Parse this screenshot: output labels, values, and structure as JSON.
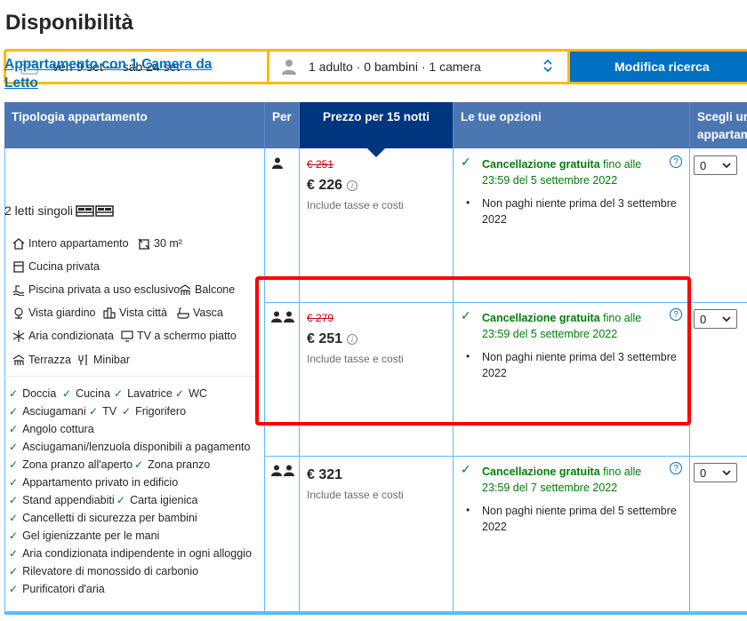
{
  "page": {
    "title": "Disponibilità"
  },
  "search": {
    "dates": "ven 9 set — sab 24 set",
    "guests": "1 adulto · 0 bambini · 1 camera",
    "button": "Modifica ricerca"
  },
  "table": {
    "headers": {
      "type": "Tipologia appartamento",
      "per": "Per",
      "price": "Prezzo per 15 notti",
      "options": "Le tue opzioni",
      "choose": "Scegli un appartam"
    },
    "room": {
      "name": "Appartamento con 1 Camera da Letto",
      "beds": "2 letti singoli",
      "facilities": [
        {
          "label": "Intero appartamento",
          "icon": "house-icon"
        },
        {
          "label": "30 m²",
          "icon": "area-icon"
        },
        {
          "label": "Cucina privata",
          "icon": "kitchen-icon"
        },
        {
          "label": "Piscina privata a uso esclusivo",
          "icon": "pool-icon"
        },
        {
          "label": "Balcone",
          "icon": "balcony-icon"
        },
        {
          "label": "Vista giardino",
          "icon": "garden-icon"
        },
        {
          "label": "Vista città",
          "icon": "city-icon"
        },
        {
          "label": "Vasca",
          "icon": "bathtub-icon"
        },
        {
          "label": "Aria condizionata",
          "icon": "snowflake-icon"
        },
        {
          "label": "TV a schermo piatto",
          "icon": "tv-icon"
        },
        {
          "label": "Terrazza",
          "icon": "terrace-icon"
        },
        {
          "label": "Minibar",
          "icon": "minibar-icon"
        }
      ],
      "amenities": [
        "Doccia",
        "Cucina",
        "Lavatrice",
        "WC",
        "Asciugamani",
        "TV",
        "Frigorifero",
        "Angolo cottura",
        "Asciugamani/lenzuola disponibili a pagamento",
        "Zona pranzo all'aperto",
        "Zona pranzo",
        "Appartamento privato in edificio",
        "Stand appendiabiti",
        "Carta igienica",
        "Cancelletti di sicurezza per bambini",
        "Gel igienizzante per le mani",
        "Aria condizionata indipendente in ogni alloggio",
        "Rilevatore di monossido di carbonio",
        "Purificatori d'aria"
      ]
    },
    "offers": [
      {
        "guests": 1,
        "old_price": "€ 251",
        "price": "€ 226",
        "price_note": "Include tasse e costi",
        "cancel_bold": "Cancellazione gratuita",
        "cancel_rest": " fino alle",
        "cancel_date": "23:59 del 5 settembre 2022",
        "pay_note": "Non paghi niente prima del 3 settembre 2022",
        "qty": "0"
      },
      {
        "guests": 2,
        "old_price": "€ 279",
        "price": "€ 251",
        "price_note": "Include tasse e costi",
        "cancel_bold": "Cancellazione gratuita",
        "cancel_rest": " fino alle",
        "cancel_date": "23:59 del 5 settembre 2022",
        "pay_note": "Non paghi niente prima del 3 settembre 2022",
        "qty": "0"
      },
      {
        "guests": 2,
        "old_price": "",
        "price": "€ 321",
        "price_note": "Include tasse e costi",
        "cancel_bold": "Cancellazione gratuita",
        "cancel_rest": " fino alle",
        "cancel_date": "23:59 del 7 settembre 2022",
        "pay_note": "Non paghi niente prima del 5 settembre 2022",
        "qty": "0"
      }
    ]
  },
  "colors": {
    "header_bg": "#4c76b2",
    "price_header_bg": "#003580",
    "accent_blue": "#0071c2",
    "search_border": "#febb02",
    "green": "#008009",
    "old_price_red": "#cc0000",
    "highlight": "#ff0000"
  }
}
